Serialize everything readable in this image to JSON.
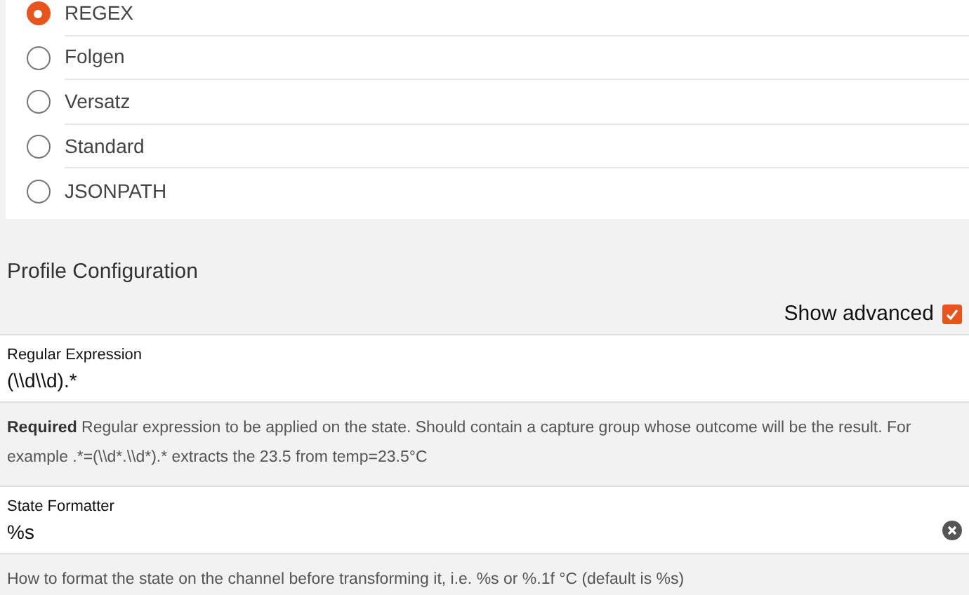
{
  "options": [
    {
      "label": "REGEX",
      "selected": true
    },
    {
      "label": "Folgen",
      "selected": false
    },
    {
      "label": "Versatz",
      "selected": false
    },
    {
      "label": "Standard",
      "selected": false
    },
    {
      "label": "JSONPATH",
      "selected": false
    }
  ],
  "section_title": "Profile Configuration",
  "show_advanced": {
    "label": "Show advanced",
    "checked": true
  },
  "fields": [
    {
      "label": "Regular Expression",
      "value": "(\\\\d\\\\d).*",
      "clearable": false,
      "help_bold": "Required",
      "help": "Regular expression to be applied on the state. Should contain a capture group whose outcome will be the result. For example .*=(\\\\d*.\\\\d*).* extracts the 23.5 from temp=23.5°C"
    },
    {
      "label": "State Formatter",
      "value": "%s",
      "clearable": true,
      "help": "How to format the state on the channel before transforming it, i.e. %s or %.1f °C (default is %s)"
    }
  ]
}
